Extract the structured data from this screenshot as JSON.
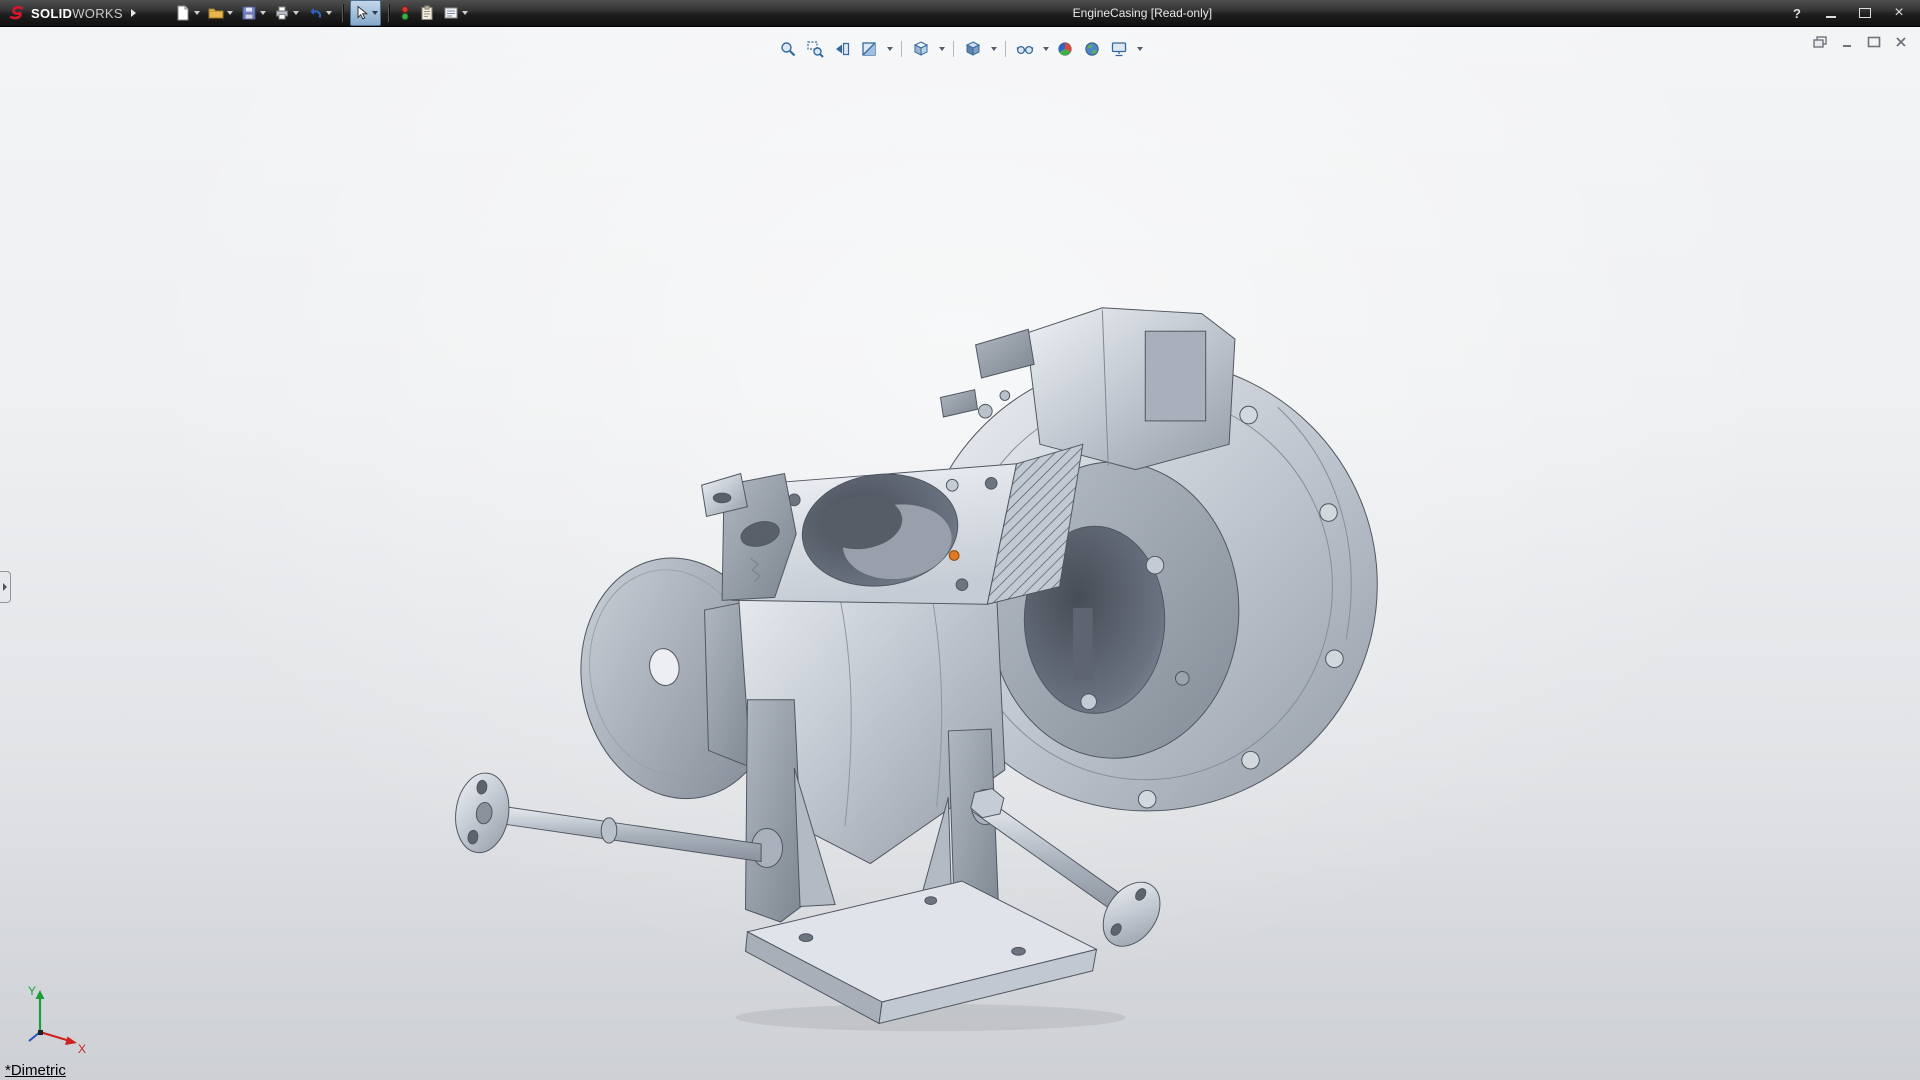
{
  "titlebar": {
    "brand_prefix": "SOLID",
    "brand_suffix": "WORKS",
    "title": "EngineCasing [Read-only]",
    "help_glyph": "?",
    "close_glyph": "×",
    "tools": [
      {
        "name": "new-document"
      },
      {
        "name": "open"
      },
      {
        "name": "save"
      },
      {
        "name": "print"
      },
      {
        "name": "undo"
      },
      {
        "name": "select"
      },
      {
        "name": "solidworks-xpress"
      },
      {
        "name": "file-properties"
      },
      {
        "name": "options"
      }
    ],
    "window_controls": [
      "help",
      "minimize",
      "restore",
      "close"
    ]
  },
  "document_window_controls": [
    "restore-document",
    "minimize-document",
    "maximize-document",
    "close-document"
  ],
  "heads_up_toolbar": {
    "items": [
      "zoom-to-fit",
      "zoom-to-area",
      "previous-view",
      "section-view",
      "view-orientation",
      "display-style",
      "hide-show-items",
      "edit-appearance",
      "apply-scene",
      "view-settings"
    ]
  },
  "viewport": {
    "orientation_label": "*Dimetric",
    "triad": {
      "x_label": "X",
      "y_label": "Y"
    }
  },
  "colors": {
    "brand_red": "#d5172f",
    "titlebar_bg": "#2b2b2b",
    "viewport_top": "#f3f4f6",
    "viewport_bottom": "#cdd0d4",
    "selection_marker_orange": "#e0791f",
    "triad_x_red": "#cc2222",
    "triad_y_green": "#1e9e3a",
    "triad_z_blue": "#2a52be"
  }
}
